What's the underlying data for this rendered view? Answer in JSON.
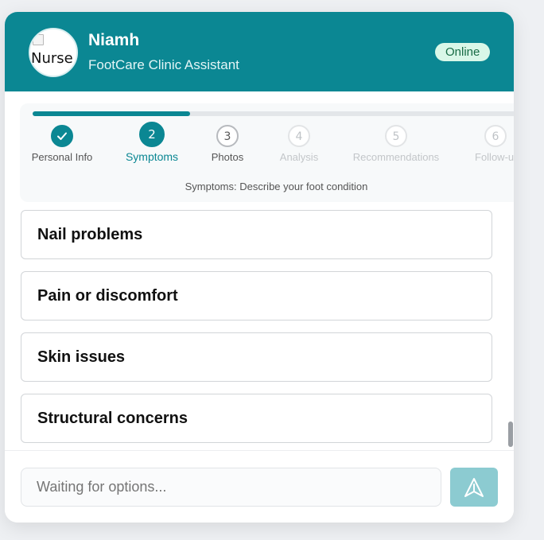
{
  "header": {
    "avatar_alt": "Nurse",
    "name": "Niamh",
    "role": "FootCare Clinic Assistant",
    "status": "Online"
  },
  "progress": {
    "fraction": 0.32,
    "steps": [
      {
        "number": "1",
        "label": "Personal Info",
        "state": "done"
      },
      {
        "number": "2",
        "label": "Symptoms",
        "state": "active"
      },
      {
        "number": "3",
        "label": "Photos",
        "state": "next"
      },
      {
        "number": "4",
        "label": "Analysis",
        "state": "future"
      },
      {
        "number": "5",
        "label": "Recommendations",
        "state": "future"
      },
      {
        "number": "6",
        "label": "Follow-up",
        "state": "future"
      }
    ],
    "description": "Symptoms: Describe your foot condition"
  },
  "options": [
    {
      "label": "Nail problems"
    },
    {
      "label": "Pain or discomfort"
    },
    {
      "label": "Skin issues"
    },
    {
      "label": "Structural concerns"
    }
  ],
  "composer": {
    "placeholder": "Waiting for options..."
  },
  "colors": {
    "brand": "#0b8793",
    "send_disabled": "#8ccbd1",
    "status_bg": "#d9f7e8"
  }
}
